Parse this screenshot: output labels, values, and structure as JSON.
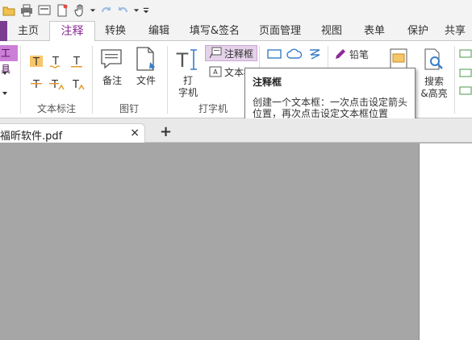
{
  "tabs": {
    "items": [
      "主页",
      "注释",
      "转换",
      "编辑",
      "填写&签名",
      "页面管理",
      "视图",
      "表单",
      "保护",
      "共享"
    ],
    "active": "注释"
  },
  "ribbon": {
    "tools_label": "工具",
    "groups": {
      "text_markup": "文本标注",
      "stamp": "图钉",
      "typewriter": "打字机"
    },
    "buttons": {
      "note": "备注",
      "file": "文件",
      "typewriter_line1": "打",
      "typewriter_line2": "字机",
      "callout": "注释框",
      "textbox": "文本框",
      "pencil": "铅笔",
      "search_line1": "搜索",
      "search_line2": "&高亮"
    }
  },
  "tooltip": {
    "title": "注释框",
    "body_line1": "创建一个文本框：一次点击设定箭头",
    "body_line2": "位置，再次点击设定文本框位置"
  },
  "doc_tab": {
    "title": "福昕软件.pdf",
    "close": "×",
    "new_tab": "+"
  },
  "colors": {
    "accent": "#8a2c96",
    "tool_strip": "#cc7fd6",
    "canvas_bg": "#a6a6a6"
  }
}
